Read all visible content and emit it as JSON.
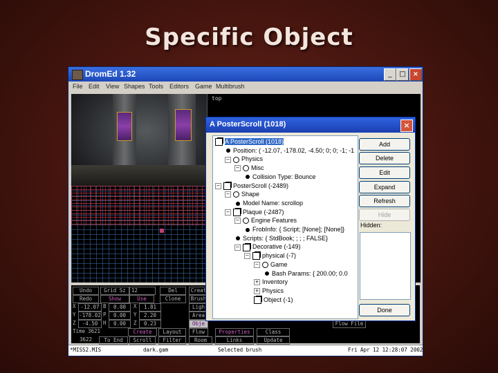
{
  "slide": {
    "title": "Specific Object"
  },
  "window": {
    "title": "DromEd  1.32",
    "controls": {
      "minimize": "_",
      "maximize": "□",
      "close": "×"
    },
    "menu": [
      "File",
      "Edit",
      "View",
      "Shapes",
      "Tools",
      "Editors",
      "Game",
      "Multibrush"
    ],
    "views": {
      "top_label": "top"
    }
  },
  "panel": {
    "row1": {
      "undo": "Undo",
      "grid_label": "Grid Sz",
      "grid_value": "12",
      "del": "Del",
      "create": "Creat"
    },
    "row2": {
      "redo": "Redo",
      "show": "Show",
      "use": "Use",
      "clone": "Clone",
      "brush": "Brush"
    },
    "coords": [
      {
        "axis": "X",
        "pos": "-12.07",
        "rot_label": "B",
        "rot": "0.00",
        "dim_label": "X",
        "dim": "1.81",
        "extra": "Ligh"
      },
      {
        "axis": "Y",
        "pos": "-178.02",
        "rot_label": "P",
        "rot": "0.00",
        "dim_label": "Y",
        "dim": "2.20",
        "extra": "Area"
      },
      {
        "axis": "Z",
        "pos": "-4.50",
        "rot_label": "H",
        "rot": "0.00",
        "dim_label": "Z",
        "dim": "0.23",
        "extra": "Obje"
      }
    ],
    "time_label": "Time",
    "time_value": "3621",
    "frame_value": "3622",
    "bottom_row1": [
      "Create",
      "Layout",
      "Flow",
      "Properties",
      "Class"
    ],
    "bottom_row2": [
      "To End",
      "Scroll",
      "Filter",
      "Room",
      "Links",
      "Update"
    ],
    "flow_file": "Flow File"
  },
  "status": {
    "mission": "*MISS2.MIS",
    "gam": "dark.gam",
    "selection": "Selected brush",
    "datetime": "Fri Apr 12 12:28:07 2002"
  },
  "dialog": {
    "title": "A PosterScroll (1018)",
    "close": "×",
    "tree": [
      {
        "text": "A PosterScroll (1018)",
        "indent": 0,
        "icon": "cube",
        "expander": "",
        "selected": true
      },
      {
        "text": "Position: ( -12.07, -178.02, -4.50; 0; 0; -1; -1",
        "indent": 1,
        "icon": "dot",
        "expander": ""
      },
      {
        "text": "Physics",
        "indent": 1,
        "icon": "circle",
        "expander": "−"
      },
      {
        "text": "Misc",
        "indent": 2,
        "icon": "circle",
        "expander": "−"
      },
      {
        "text": "Collision Type: Bounce",
        "indent": 3,
        "icon": "dot",
        "expander": ""
      },
      {
        "text": "PosterScroll (-2489)",
        "indent": 0,
        "icon": "cube",
        "expander": "−"
      },
      {
        "text": "Shape",
        "indent": 1,
        "icon": "circle",
        "expander": "−"
      },
      {
        "text": "Model Name: scrollop",
        "indent": 2,
        "icon": "dot",
        "expander": ""
      },
      {
        "text": "Plaque (-2487)",
        "indent": 1,
        "icon": "cube",
        "expander": "−"
      },
      {
        "text": "Engine Features",
        "indent": 2,
        "icon": "circle",
        "expander": "−"
      },
      {
        "text": "FrobInfo: { Script; [None]; [None]}",
        "indent": 3,
        "icon": "dot",
        "expander": ""
      },
      {
        "text": "Scripts: { StdBook; ; ; ; FALSE}",
        "indent": 2,
        "icon": "dot",
        "expander": ""
      },
      {
        "text": "Decorative (-149)",
        "indent": 2,
        "icon": "cube",
        "expander": "−"
      },
      {
        "text": "physical (-7)",
        "indent": 3,
        "icon": "cube",
        "expander": "−"
      },
      {
        "text": "Game",
        "indent": 4,
        "icon": "circle",
        "expander": "−"
      },
      {
        "text": "Bash Params: { 200.00; 0.0",
        "indent": 5,
        "icon": "dot",
        "expander": ""
      },
      {
        "text": "Inventory",
        "indent": 4,
        "icon": "",
        "expander": "+"
      },
      {
        "text": "Physics",
        "indent": 4,
        "icon": "",
        "expander": "+"
      },
      {
        "text": "Object (-1)",
        "indent": 4,
        "icon": "cube",
        "expander": ""
      }
    ],
    "buttons": {
      "add": "Add",
      "delete": "Delete",
      "edit": "Edit",
      "expand": "Expand",
      "refresh": "Refresh",
      "hide": "Hide",
      "done": "Done"
    },
    "hidden_label": "Hidden:"
  }
}
